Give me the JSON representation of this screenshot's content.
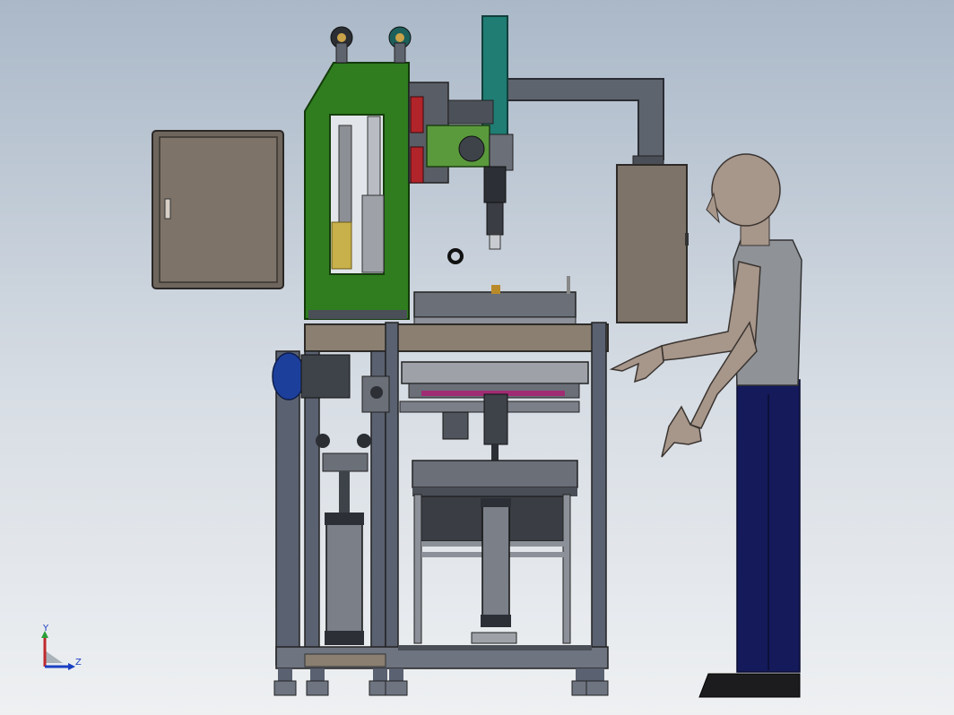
{
  "triad": {
    "y_label": "Y",
    "z_label": "Z"
  },
  "colors": {
    "background_top": "#aab8c8",
    "background_bottom": "#eef0f2",
    "frame": "#5a6170",
    "frame_dark": "#3a3f4a",
    "wood_rail": "#8a7f70",
    "green_body": "#2f7d1f",
    "teal_column": "#1f7d74",
    "control_box": "#7d7368",
    "motor_blue": "#1d3f9c",
    "mannequin_skin": "#a7968a",
    "mannequin_pants": "#141a5a",
    "mannequin_shirt": "#8f9398"
  }
}
